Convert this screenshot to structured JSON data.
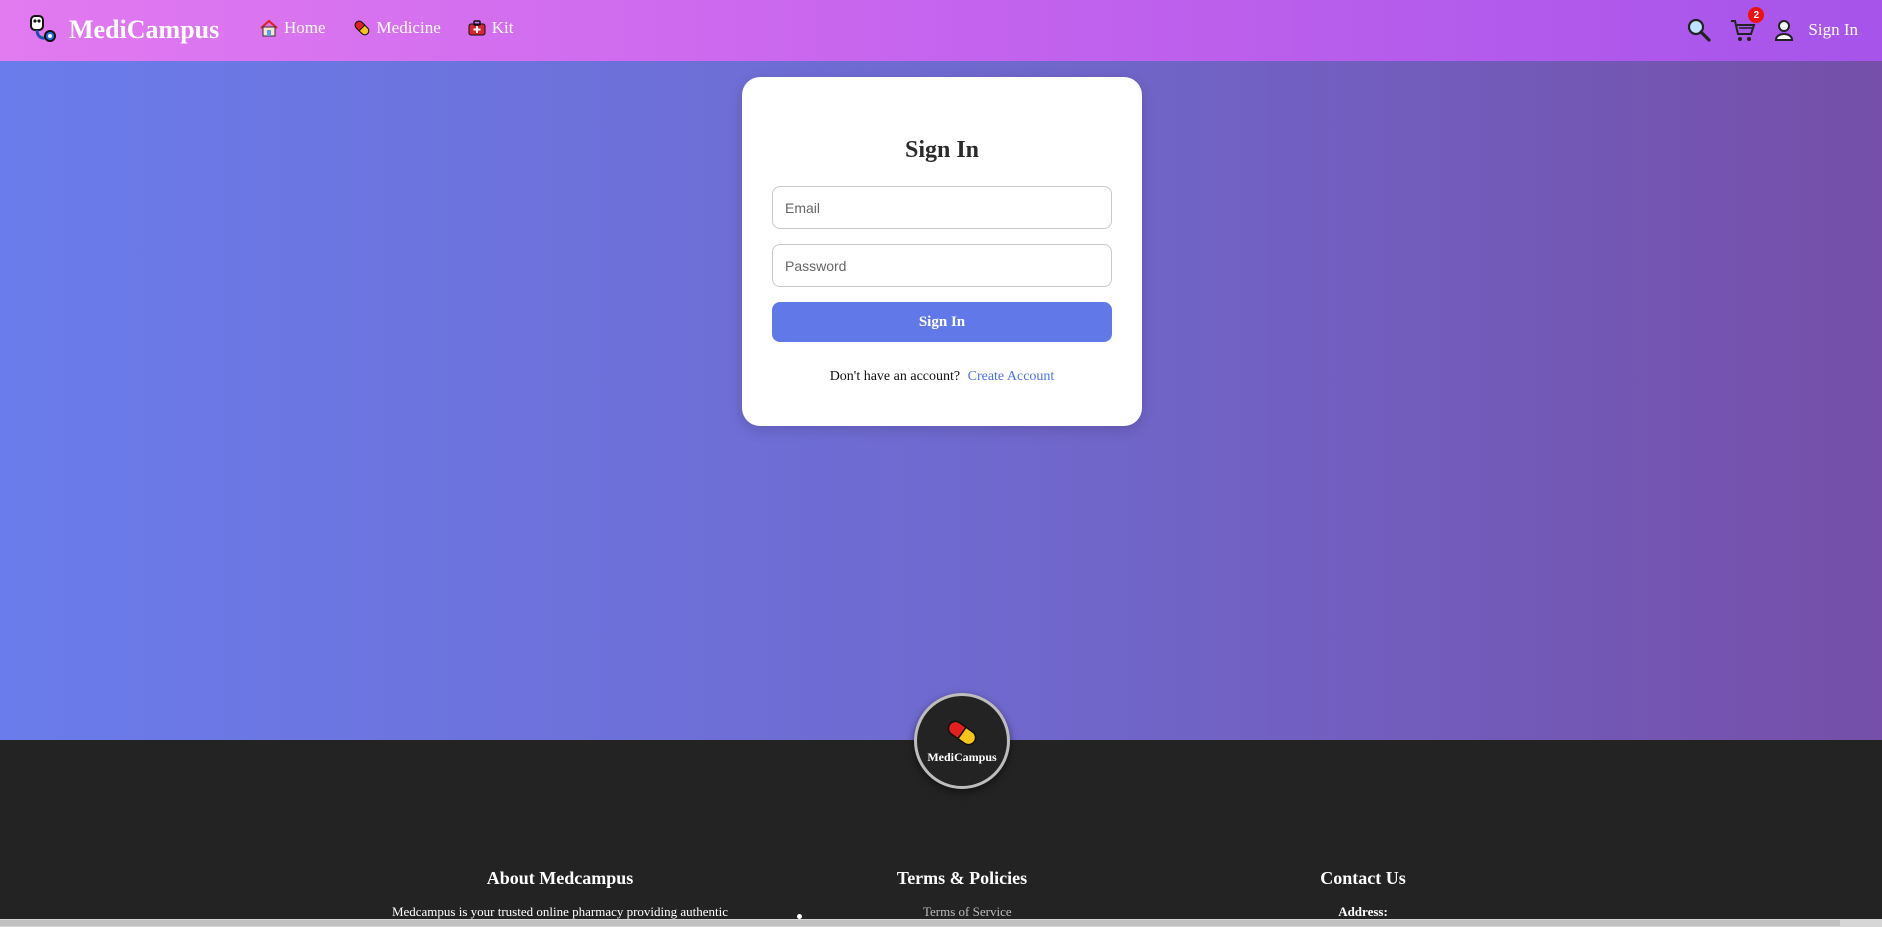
{
  "navbar": {
    "brand": "MediCampus",
    "links": [
      {
        "label": "Home",
        "icon": "house-icon"
      },
      {
        "label": "Medicine",
        "icon": "pill-icon"
      },
      {
        "label": "Kit",
        "icon": "medical-kit-icon"
      }
    ],
    "cart_count": "2",
    "signin_label": "Sign In"
  },
  "login": {
    "title": "Sign In",
    "email_placeholder": "Email",
    "password_placeholder": "Password",
    "submit_label": "Sign In",
    "no_account_text": "Don't have an account?",
    "create_account_label": "Create Account"
  },
  "footer": {
    "logo_text": "MediCampus",
    "about_title": "About Medcampus",
    "about_text": "Medcampus is your trusted online pharmacy providing authentic",
    "terms_title": "Terms & Policies",
    "terms_item": "Terms of Service",
    "contact_title": "Contact Us",
    "contact_address_label": "Address:"
  },
  "colors": {
    "nav_gradient_start": "#e27af0",
    "nav_gradient_end": "#a654ea",
    "button": "#6179e8",
    "link": "#4f72e8",
    "footer_bg": "#232323",
    "badge": "#ee1111"
  }
}
